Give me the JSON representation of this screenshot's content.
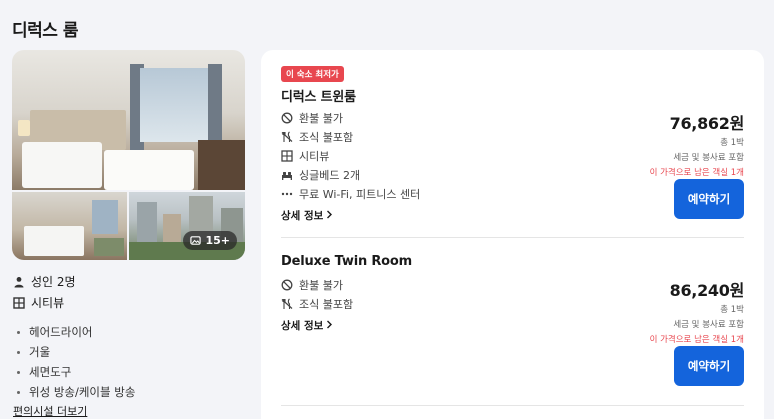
{
  "page_title": "디럭스 룸",
  "gallery": {
    "photo_count": "15+"
  },
  "occupancy": {
    "adults": "성인 2명",
    "view": "시티뷰"
  },
  "amenities": [
    "헤어드라이어",
    "거울",
    "세면도구",
    "위성 방송/케이블 방송"
  ],
  "amenities_more": "편의시설 더보기",
  "offers": [
    {
      "badge": "이 숙소 최저가",
      "name": "디럭스 트윈룸",
      "features": [
        {
          "icon": "no-refund-icon",
          "label": "환불 불가"
        },
        {
          "icon": "no-breakfast-icon",
          "label": "조식 불포함"
        },
        {
          "icon": "city-view-icon",
          "label": "시티뷰"
        },
        {
          "icon": "bed-icon",
          "label": "싱글베드 2개"
        },
        {
          "icon": "more-icon",
          "label": "무료 Wi-Fi, 피트니스 센터"
        }
      ],
      "details": "상세 정보",
      "price": "76,862원",
      "nights": "총 1박",
      "tax": "세금 및 봉사료 포함",
      "warning": "이 가격으로 남은 객실 1개",
      "book": "예약하기"
    },
    {
      "name": "Deluxe Twin Room",
      "features": [
        {
          "icon": "no-refund-icon",
          "label": "환불 불가"
        },
        {
          "icon": "no-breakfast-icon",
          "label": "조식 불포함"
        }
      ],
      "details": "상세 정보",
      "price": "86,240원",
      "nights": "총 1박",
      "tax": "세금 및 봉사료 포함",
      "warning": "이 가격으로 남은 객실 1개",
      "book": "예약하기"
    }
  ]
}
